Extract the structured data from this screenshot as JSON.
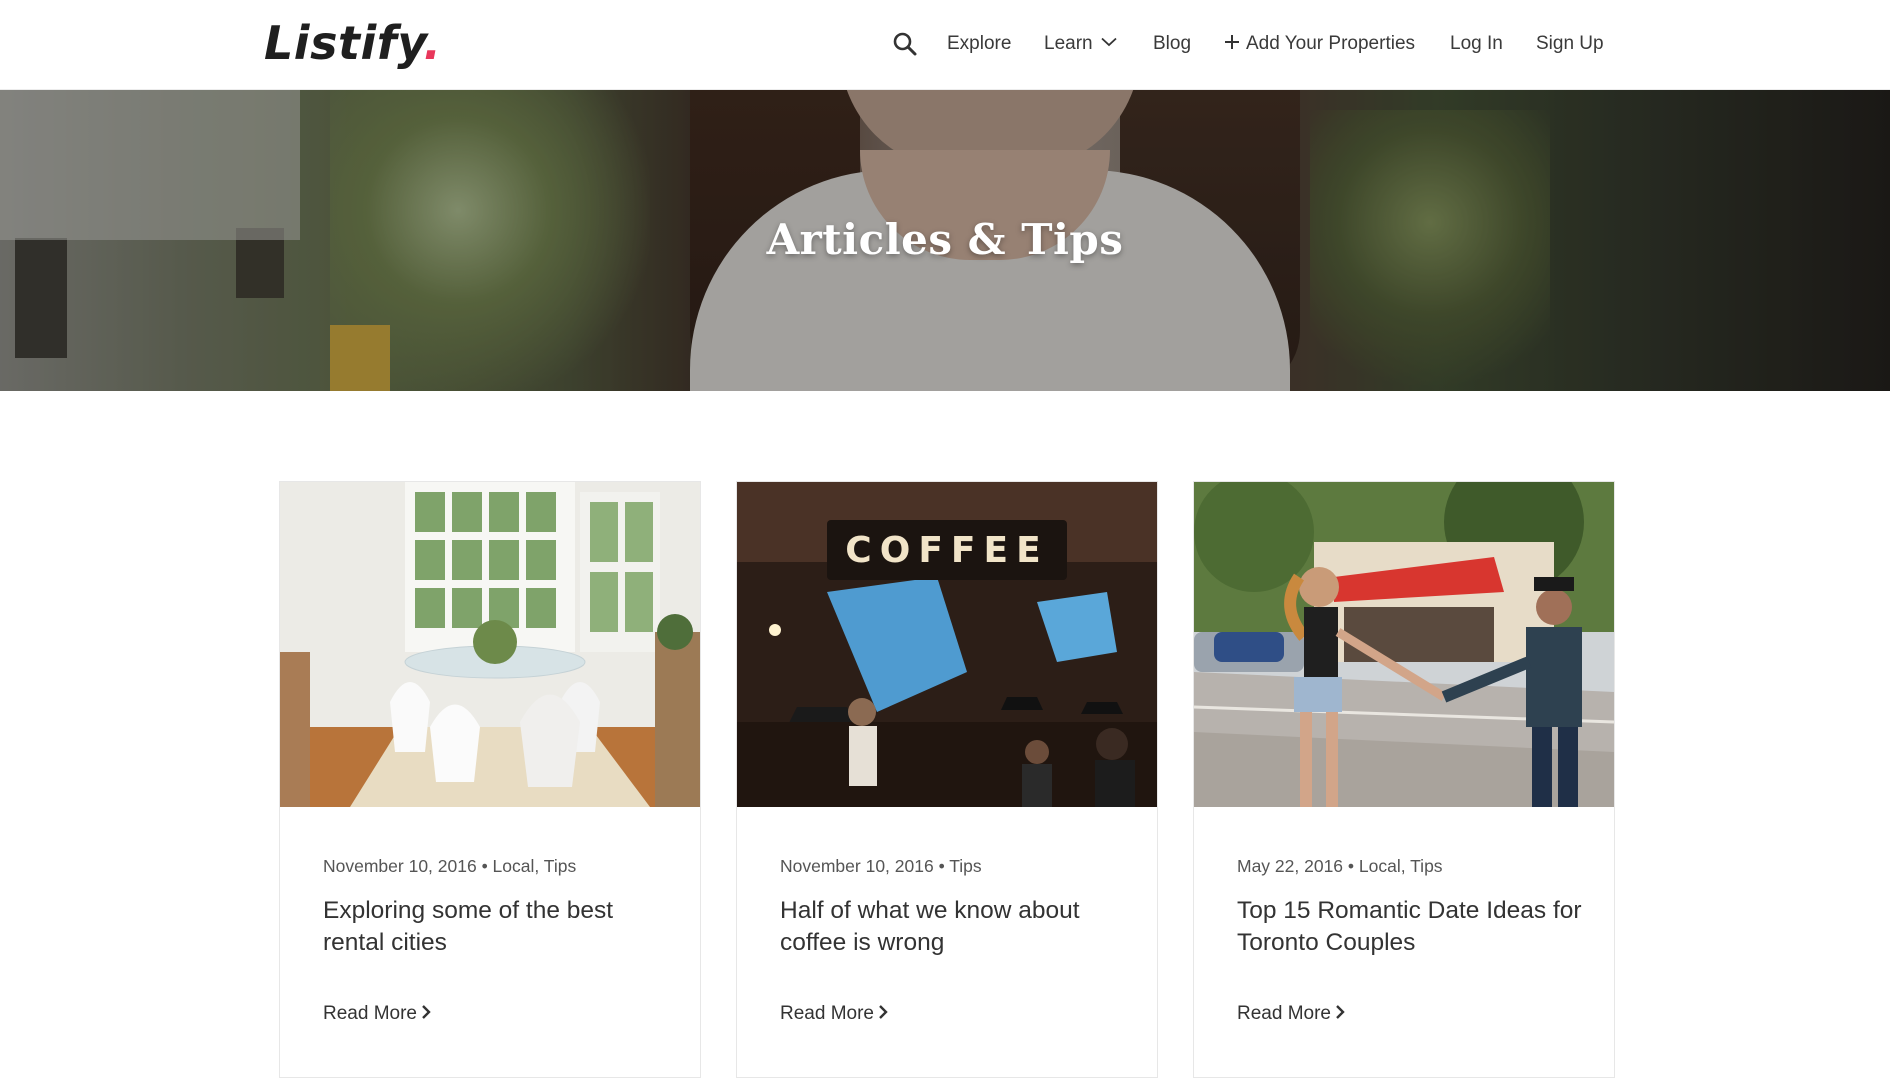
{
  "brand": {
    "name": "Listify",
    "dot": ".",
    "accent": "#e8375b"
  },
  "nav": {
    "search_icon": "search-icon",
    "explore": "Explore",
    "learn": "Learn",
    "blog": "Blog",
    "add_properties": "Add Your Properties",
    "log_in": "Log In",
    "sign_up": "Sign Up"
  },
  "hero": {
    "title": "Articles & Tips"
  },
  "articles": [
    {
      "meta": "November 10, 2016 • Local, Tips",
      "title": "Exploring some of the best rental cities",
      "read_more": "Read More",
      "image_subject": "dining-room"
    },
    {
      "meta": "November 10, 2016 • Tips",
      "title": "Half of what we know about coffee is wrong",
      "read_more": "Read More",
      "image_subject": "coffee-shop",
      "image_sign": "COFFEE"
    },
    {
      "meta": "May 22, 2016 • Local, Tips",
      "title": "Top 15 Romantic Date Ideas for Toronto Couples",
      "read_more": "Read More",
      "image_subject": "couple-street"
    }
  ]
}
